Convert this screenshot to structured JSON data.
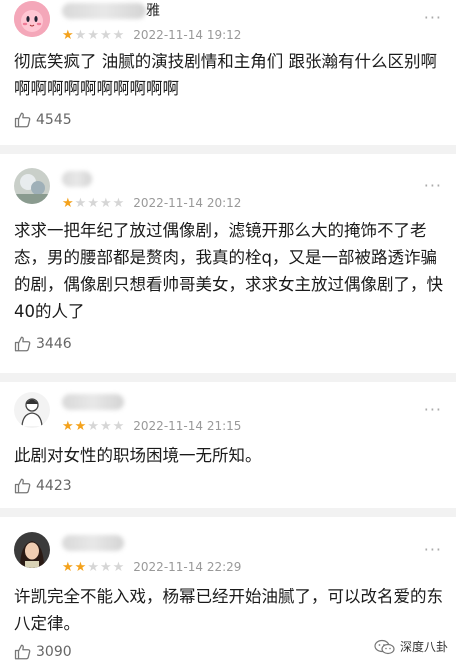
{
  "reviews": [
    {
      "username_visible": "雅",
      "time": "2022-11-14 19:12",
      "rating": 1,
      "text": "彻底笑疯了 油腻的演技剧情和主角们 跟张瀚有什么区别啊啊啊啊啊啊啊啊啊啊啊",
      "likes": "4545"
    },
    {
      "username_visible": "",
      "time": "2022-11-14 20:12",
      "rating": 1,
      "text": "求求一把年纪了放过偶像剧，滤镜开那么大的掩饰不了老态，男的腰部都是赘肉，我真的栓q，又是一部被路透诈骗的剧，偶像剧只想看帅哥美女，求求女主放过偶像剧了，快40的人了",
      "likes": "3446"
    },
    {
      "username_visible": "",
      "time": "2022-11-14 21:15",
      "rating": 2,
      "text": "此剧对女性的职场困境一无所知。",
      "likes": "4423"
    },
    {
      "username_visible": "",
      "time": "2022-11-14 22:29",
      "rating": 2,
      "text": "许凯完全不能入戏，杨幂已经开始油腻了，可以改名爱的东八定律。",
      "likes": "3090"
    }
  ],
  "watermark": "深度八卦",
  "more_icon": "more-dots-icon",
  "like_icon": "thumbs-up-icon",
  "colors": {
    "star_on": "#f4a21c",
    "star_off": "#d6d6d6",
    "background": "#f2f2f2"
  }
}
